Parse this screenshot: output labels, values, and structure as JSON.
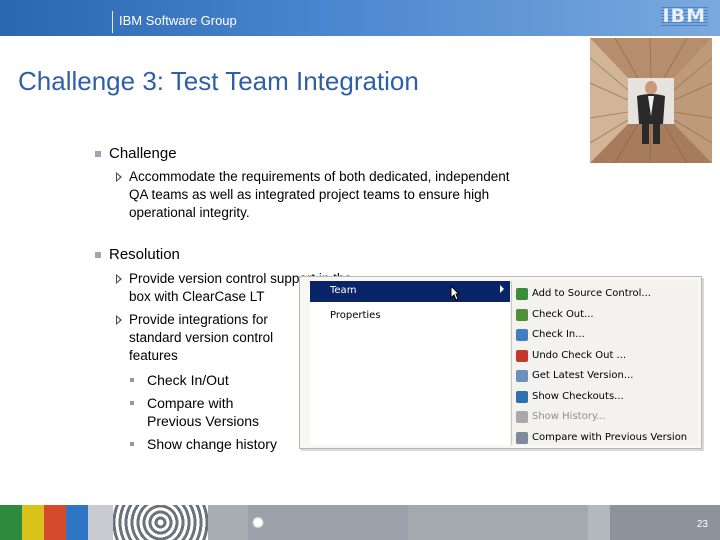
{
  "header": {
    "group": "IBM Software Group",
    "logo_text": "IBM"
  },
  "slide": {
    "title": "Challenge 3: Test Team Integration",
    "challenge": {
      "heading": "Challenge",
      "items": [
        "Accommodate the requirements of both dedicated, independent QA teams as well as integrated project teams to ensure high operational integrity."
      ]
    },
    "resolution": {
      "heading": "Resolution",
      "items": [
        "Provide version control support in the box with ClearCase LT",
        "Provide integrations for standard version control features"
      ],
      "sub_items": [
        "Check In/Out",
        "Compare with Previous Versions",
        "Show change history"
      ]
    },
    "page_number": "23"
  },
  "context_menu": {
    "left_items": [
      {
        "label": "Team",
        "selected": true
      },
      {
        "label": "Properties",
        "selected": false
      }
    ],
    "submenu": [
      {
        "label": "Add to Source Control...",
        "icon": "add-source-icon",
        "disabled": false
      },
      {
        "label": "Check Out...",
        "icon": "check-out-icon",
        "disabled": false
      },
      {
        "label": "Check In...",
        "icon": "check-in-icon",
        "disabled": false
      },
      {
        "label": "Undo Check Out ...",
        "icon": "undo-check-out-icon",
        "disabled": false
      },
      {
        "label": "Get Latest Version...",
        "icon": "get-latest-icon",
        "disabled": false
      },
      {
        "label": "Show Checkouts...",
        "icon": "show-checkouts-icon",
        "disabled": false
      },
      {
        "label": "Show History...",
        "icon": "show-history-icon",
        "disabled": true
      },
      {
        "label": "Compare with Previous Version",
        "icon": "compare-icon",
        "disabled": false
      }
    ]
  },
  "colors": {
    "title": "#2f5fa9",
    "menu_selection": "#0a246a",
    "header_start": "#2b66b0"
  }
}
